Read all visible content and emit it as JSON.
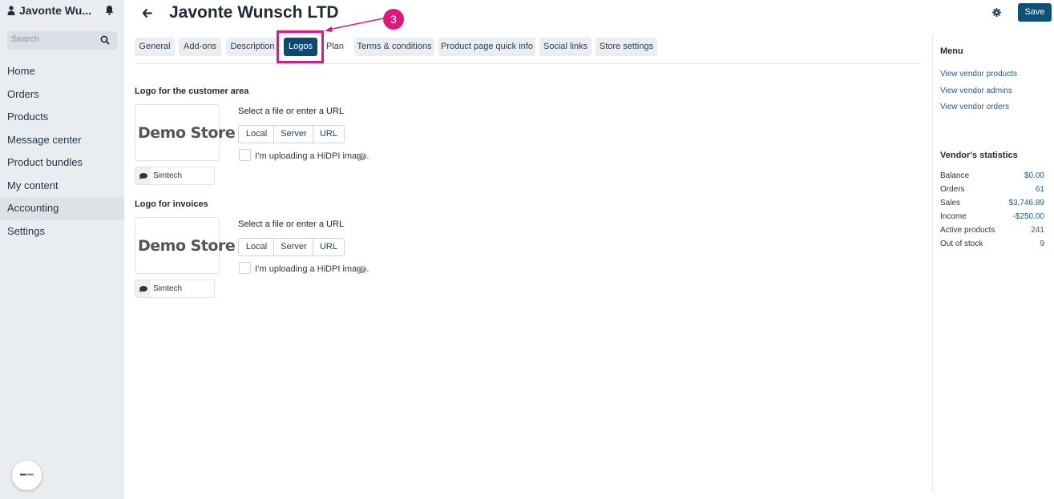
{
  "sidebar": {
    "user_name": "Javonte Wu...",
    "search_placeholder": "Search",
    "items": [
      {
        "label": "Home"
      },
      {
        "label": "Orders"
      },
      {
        "label": "Products"
      },
      {
        "label": "Message center"
      },
      {
        "label": "Product bundles"
      },
      {
        "label": "My content"
      },
      {
        "label": "Accounting"
      },
      {
        "label": "Settings"
      }
    ]
  },
  "header": {
    "title": "Javonte Wunsch LTD",
    "save_label": "Save"
  },
  "tabs": [
    {
      "label": "General"
    },
    {
      "label": "Add-ons"
    },
    {
      "label": "Description"
    },
    {
      "label": "Logos"
    },
    {
      "label": "Plan"
    },
    {
      "label": "Terms & conditions"
    },
    {
      "label": "Product page quick info"
    },
    {
      "label": "Social links"
    },
    {
      "label": "Store settings"
    }
  ],
  "callout_number": "3",
  "logos": [
    {
      "title": "Logo for the customer area",
      "logo_text": "Demo Store",
      "alt_text": "Simtech",
      "file_label": "Select a file or enter a URL",
      "buttons": [
        "Local",
        "Server",
        "URL"
      ],
      "hidpi_label": "I’m uploading a HiDPI image."
    },
    {
      "title": "Logo for invoices",
      "logo_text": "Demo Store",
      "alt_text": "Simtech",
      "file_label": "Select a file or enter a URL",
      "buttons": [
        "Local",
        "Server",
        "URL"
      ],
      "hidpi_label": "I’m uploading a HiDPI image."
    }
  ],
  "right_panel": {
    "menu_title": "Menu",
    "menu_links": [
      "View vendor products",
      "View vendor admins",
      "View vendor orders"
    ],
    "stats_title": "Vendor's statistics",
    "stats": [
      {
        "label": "Balance",
        "value": "$0.00"
      },
      {
        "label": "Orders",
        "value": "61"
      },
      {
        "label": "Sales",
        "value": "$3,746.89"
      },
      {
        "label": "Income",
        "value": "-$250.00"
      },
      {
        "label": "Active products",
        "value": "241"
      },
      {
        "label": "Out of stock",
        "value": "9"
      }
    ]
  },
  "colors": {
    "accent": "#0e4a6f",
    "callout": "#e0187d",
    "link": "#1a5d8f"
  }
}
